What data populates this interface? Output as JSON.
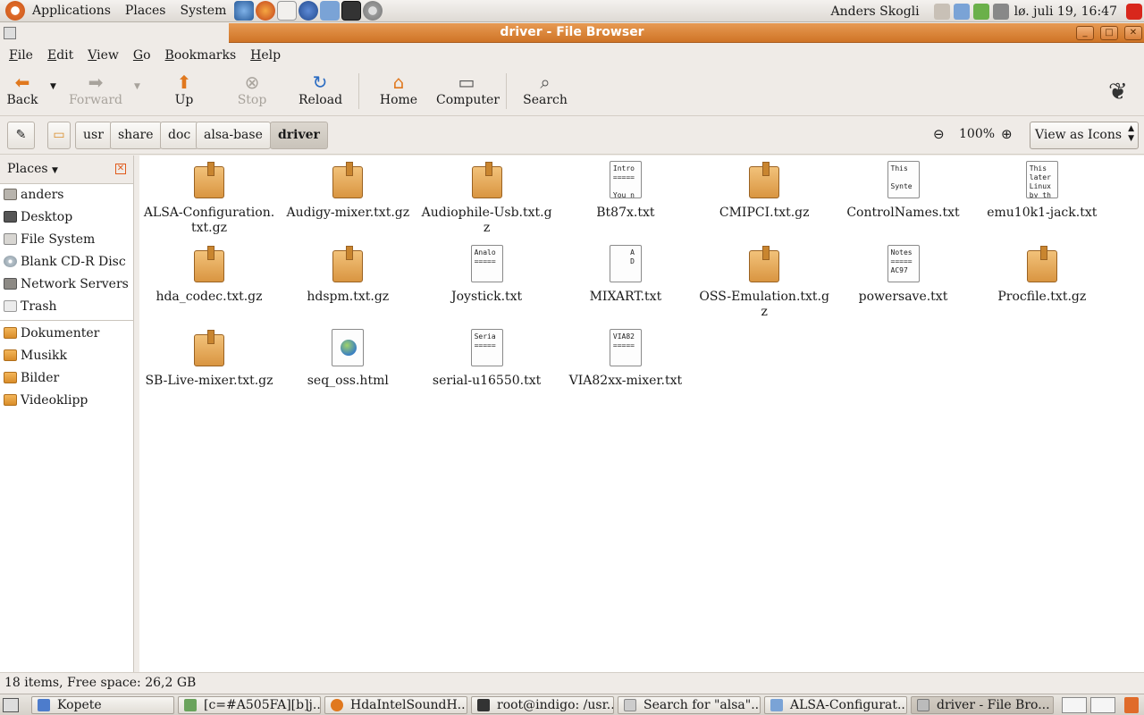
{
  "top_panel": {
    "menus": [
      "Applications",
      "Places",
      "System"
    ],
    "user": "Anders Skogli",
    "clock": "lø. juli 19, 16:47"
  },
  "window": {
    "title": "driver - File Browser",
    "controls": [
      "minimize",
      "maximize",
      "close"
    ]
  },
  "menubar": [
    "File",
    "Edit",
    "View",
    "Go",
    "Bookmarks",
    "Help"
  ],
  "toolbar": {
    "back": "Back",
    "forward": "Forward",
    "up": "Up",
    "stop": "Stop",
    "reload": "Reload",
    "home": "Home",
    "computer": "Computer",
    "search": "Search"
  },
  "location": {
    "crumbs": [
      "usr",
      "share",
      "doc",
      "alsa-base",
      "driver"
    ],
    "zoom": "100%",
    "view_mode": "View as Icons"
  },
  "sidebar": {
    "header": "Places",
    "system_places": [
      "anders",
      "Desktop",
      "File System",
      "Blank CD-R Disc",
      "Network Servers",
      "Trash"
    ],
    "bookmarks": [
      "Dokumenter",
      "Musikk",
      "Bilder",
      "Videoklipp"
    ]
  },
  "files": [
    {
      "name": "ALSA-Configuration.txt.gz",
      "type": "pkg",
      "preview": ""
    },
    {
      "name": "Audigy-mixer.txt.gz",
      "type": "pkg",
      "preview": ""
    },
    {
      "name": "Audiophile-Usb.txt.gz",
      "type": "pkg",
      "preview": ""
    },
    {
      "name": "Bt87x.txt",
      "type": "txt",
      "preview": "Intro\n=====\n\nYou n"
    },
    {
      "name": "CMIPCI.txt.gz",
      "type": "pkg",
      "preview": ""
    },
    {
      "name": "ControlNames.txt",
      "type": "txt",
      "preview": "This\n\nSynte"
    },
    {
      "name": "emu10k1-jack.txt",
      "type": "txt",
      "preview": "This\nlater\nLinux\nby th"
    },
    {
      "name": "hda_codec.txt.gz",
      "type": "pkg",
      "preview": ""
    },
    {
      "name": "hdspm.txt.gz",
      "type": "pkg",
      "preview": ""
    },
    {
      "name": "Joystick.txt",
      "type": "txt",
      "preview": "Analo\n====="
    },
    {
      "name": "MIXART.txt",
      "type": "txt",
      "preview": "    A\n    D"
    },
    {
      "name": "OSS-Emulation.txt.gz",
      "type": "pkg",
      "preview": ""
    },
    {
      "name": "powersave.txt",
      "type": "txt",
      "preview": "Notes\n=====\nAC97"
    },
    {
      "name": "Procfile.txt.gz",
      "type": "pkg",
      "preview": ""
    },
    {
      "name": "SB-Live-mixer.txt.gz",
      "type": "pkg",
      "preview": ""
    },
    {
      "name": "seq_oss.html",
      "type": "html",
      "preview": ""
    },
    {
      "name": "serial-u16550.txt",
      "type": "txt",
      "preview": "Seria\n====="
    },
    {
      "name": "VIA82xx-mixer.txt",
      "type": "txt",
      "preview": "VIA82\n====="
    }
  ],
  "status": "18 items, Free space: 26,2 GB",
  "taskbar": [
    "Kopete",
    "[c=#A505FA][b]j...",
    "HdaIntelSoundH...",
    "root@indigo: /usr...",
    "Search for \"alsa\"...",
    "ALSA-Configurat...",
    "driver - File Bro..."
  ],
  "colors": {
    "titlebar": "#cf7426",
    "accent_orange": "#e06b2a",
    "background": "#efebe7"
  }
}
